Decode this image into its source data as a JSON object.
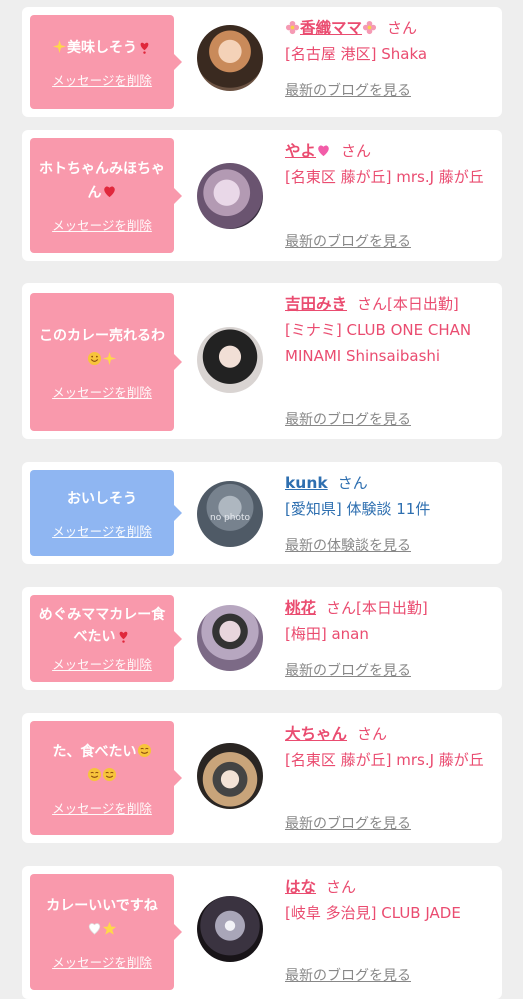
{
  "cards": [
    {
      "message": "美味しそう",
      "emoji_after": [
        "sparkle-icon",
        "heart-exclaim-icon"
      ],
      "delete_label": "メッセージを削除",
      "name": "香織ママ",
      "suffix": "さん",
      "location": "[名古屋 港区] Shaka",
      "link": "最新のブログを見る",
      "color": "pink"
    },
    {
      "message": "ホトちゃんみほちゃん",
      "delete_label": "メッセージを削除",
      "name": "やよ",
      "suffix": "さん",
      "location": "[名東区 藤が丘] mrs.J 藤が丘",
      "link": "最新のブログを見る",
      "color": "pink"
    },
    {
      "message": "このカレー売れるわ",
      "delete_label": "メッセージを削除",
      "name": "吉田みき",
      "suffix": "さん[本日出勤]",
      "location": "[ミナミ] CLUB ONE CHAN MINAMI Shinsaibashi",
      "link": "最新のブログを見る",
      "color": "pink"
    },
    {
      "message": "おいしそう",
      "delete_label": "メッセージを削除",
      "name": "kunk",
      "suffix": "さん",
      "location": "[愛知県] 体験談 11件",
      "link": "最新の体験談を見る",
      "avatar_text": "no photo",
      "color": "blue"
    },
    {
      "message": "めぐみママカレー食べたい",
      "delete_label": "メッセージを削除",
      "name": "桃花",
      "suffix": "さん[本日出勤]",
      "location": "[梅田] anan",
      "link": "最新のブログを見る",
      "color": "pink"
    },
    {
      "message": "た、食べたい",
      "delete_label": "メッセージを削除",
      "name": "大ちゃん",
      "suffix": "さん",
      "location": "[名東区 藤が丘] mrs.J 藤が丘",
      "link": "最新のブログを見る",
      "color": "pink"
    },
    {
      "message": "カレーいいですね",
      "delete_label": "メッセージを削除",
      "name": "はな",
      "suffix": "さん",
      "location": "[岐阜 多治見] CLUB JADE",
      "link": "最新のブログを見る",
      "color": "pink"
    }
  ]
}
